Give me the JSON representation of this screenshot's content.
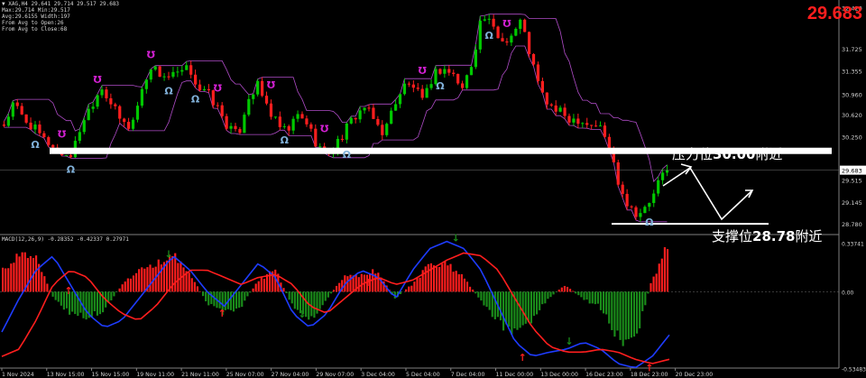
{
  "header": {
    "symbol_line": "▼ XAG,H4   29.641 29.714 29.517 29.683",
    "stats": [
      "Max:29.714 Min:29.517",
      "Avg:29.6155 Width:197",
      "From Avg to Open:26",
      "From Avg to Close:68"
    ],
    "current_price": "29.683"
  },
  "annotations": {
    "resistance_prefix": "压力位",
    "resistance_value": "30.00",
    "resistance_suffix": "附近",
    "support_prefix": "支撑位",
    "support_value": "28.78",
    "support_suffix": "附近"
  },
  "macd_title": "MACD(12,26,9) -0.28352 -0.42337 0.27971",
  "colors": {
    "background": "#000000",
    "bull": "#00c800",
    "bear": "#ff1e1e",
    "band": "#b04cc8",
    "macd_line": "#1e3cff",
    "signal_line": "#ff1e1e",
    "hist_pos": "#ff1e1e",
    "hist_neg": "#1a8c1a",
    "fractal_up": "#d020d0",
    "fractal_down": "#80b0d8",
    "level": "#ffffff"
  },
  "chart_data": [
    {
      "type": "candlestick",
      "symbol": "XAG",
      "timeframe": "H4",
      "ylim": [
        28.63,
        32.5
      ],
      "y_ticks": [
        "32.420",
        "31.725",
        "31.355",
        "30.960",
        "30.620",
        "30.250",
        "29.683",
        "29.515",
        "29.145",
        "28.780"
      ],
      "x_ticks": [
        "1 Nov 2024",
        "13 Nov 15:00",
        "15 Nov 15:00",
        "19 Nov 11:00",
        "21 Nov 11:00",
        "25 Nov 07:00",
        "27 Nov 04:00",
        "29 Nov 07:00",
        "3 Dec 04:00",
        "5 Dec 04:00",
        "7 Dec 04:00",
        "11 Dec 00:00",
        "13 Dec 00:00",
        "16 Dec 23:00",
        "18 Dec 23:00",
        "20 Dec 23:00"
      ],
      "close_path": [
        30.45,
        30.8,
        30.55,
        30.4,
        30.2,
        30.1,
        29.95,
        29.95,
        30.5,
        30.8,
        31.1,
        30.8,
        30.5,
        30.4,
        30.95,
        31.45,
        31.3,
        31.25,
        31.3,
        31.4,
        31.05,
        30.95,
        30.7,
        30.4,
        30.25,
        30.9,
        31.1,
        30.75,
        30.45,
        30.3,
        30.6,
        30.5,
        30.15,
        29.95,
        30.1,
        30.35,
        30.6,
        30.75,
        30.5,
        30.3,
        30.8,
        31.1,
        31.1,
        30.8,
        31.3,
        31.4,
        31.3,
        31.05,
        31.5,
        32.3,
        32.1,
        31.85,
        31.95,
        32.2,
        31.6,
        31.0,
        30.75,
        30.65,
        30.55,
        30.55,
        30.45,
        30.45,
        30.1,
        29.5,
        29.1,
        28.95,
        29.05,
        29.45,
        29.683
      ],
      "resistance_level": 30.0,
      "support_level": 28.78,
      "current_price": 29.683
    },
    {
      "type": "macd",
      "params": "MACD(12,26,9)",
      "values": [
        -0.28352,
        -0.42337,
        0.27971
      ],
      "ylim": [
        -0.5435,
        0.36
      ],
      "y_ticks": [
        "0.33741",
        "0.00",
        "-0.53483"
      ],
      "macd_path": [
        -0.28,
        -0.05,
        0.15,
        0.25,
        0.05,
        -0.15,
        -0.25,
        -0.2,
        -0.05,
        0.1,
        0.25,
        0.15,
        0.0,
        -0.1,
        0.05,
        0.2,
        0.1,
        -0.15,
        -0.25,
        -0.15,
        0.05,
        0.15,
        0.1,
        -0.05,
        0.15,
        0.3,
        0.35,
        0.3,
        0.15,
        -0.1,
        -0.35,
        -0.45,
        -0.42,
        -0.4,
        -0.35,
        -0.4,
        -0.5,
        -0.53,
        -0.45,
        -0.3
      ],
      "signal_path": [
        -0.45,
        -0.4,
        -0.2,
        0.05,
        0.15,
        0.1,
        -0.05,
        -0.15,
        -0.2,
        -0.1,
        0.05,
        0.15,
        0.15,
        0.1,
        0.05,
        0.1,
        0.12,
        0.05,
        -0.1,
        -0.15,
        -0.05,
        0.05,
        0.1,
        0.05,
        0.08,
        0.15,
        0.22,
        0.27,
        0.25,
        0.15,
        -0.05,
        -0.25,
        -0.38,
        -0.42,
        -0.42,
        -0.4,
        -0.42,
        -0.47,
        -0.5,
        -0.47
      ],
      "histogram_path": [
        0.15,
        0.25,
        0.22,
        -0.05,
        -0.15,
        -0.18,
        -0.12,
        0.05,
        0.15,
        0.2,
        0.25,
        0.12,
        -0.08,
        -0.15,
        -0.1,
        0.08,
        0.15,
        -0.1,
        -0.2,
        -0.05,
        0.1,
        0.12,
        0.15,
        -0.05,
        0.05,
        0.18,
        0.2,
        0.1,
        -0.05,
        -0.2,
        -0.3,
        -0.2,
        -0.05,
        0.05,
        -0.05,
        -0.1,
        -0.3,
        -0.38,
        0.05,
        0.32
      ]
    }
  ]
}
